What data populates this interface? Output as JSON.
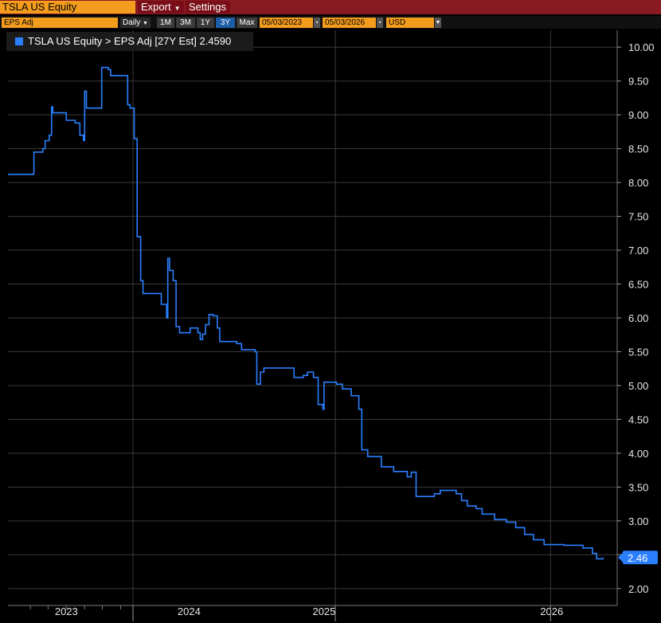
{
  "header": {
    "ticker": "TSLA US Equity",
    "export_label": "Export",
    "settings_label": "Settings"
  },
  "toolbar": {
    "field": "EPS Adj",
    "periodicity": "Daily",
    "ranges": [
      "1M",
      "3M",
      "1Y",
      "3Y",
      "Max"
    ],
    "active_range": "3Y",
    "start_date": "05/03/2023",
    "end_date": "05/03/2026",
    "currency": "USD"
  },
  "legend": {
    "text": "TSLA US Equity > EPS Adj [27Y Est]  2.4590",
    "color": "#2a7fff"
  },
  "colors": {
    "line": "#2a7fff",
    "grid": "#3a3a3a",
    "last_label_bg": "#2a7fff"
  },
  "chart_data": {
    "type": "line",
    "title": "",
    "series": [
      {
        "name": "TSLA US Equity > EPS Adj [27Y Est]",
        "last_value": 2.459,
        "last_label": "2.46",
        "points": [
          [
            "2023-05-03",
            8.12
          ],
          [
            "2023-06-15",
            8.13
          ],
          [
            "2023-06-16",
            8.45
          ],
          [
            "2023-07-01",
            8.5
          ],
          [
            "2023-07-05",
            8.62
          ],
          [
            "2023-07-12",
            8.7
          ],
          [
            "2023-07-16",
            9.12
          ],
          [
            "2023-07-18",
            9.03
          ],
          [
            "2023-08-10",
            8.92
          ],
          [
            "2023-08-25",
            8.88
          ],
          [
            "2023-09-02",
            8.7
          ],
          [
            "2023-09-08",
            8.62
          ],
          [
            "2023-09-10",
            9.35
          ],
          [
            "2023-09-13",
            9.1
          ],
          [
            "2023-10-08",
            9.1
          ],
          [
            "2023-10-09",
            9.7
          ],
          [
            "2023-10-20",
            9.67
          ],
          [
            "2023-10-24",
            9.58
          ],
          [
            "2023-11-20",
            9.58
          ],
          [
            "2023-11-22",
            9.15
          ],
          [
            "2023-11-26",
            9.1
          ],
          [
            "2023-12-03",
            8.65
          ],
          [
            "2023-12-08",
            7.2
          ],
          [
            "2023-12-14",
            6.55
          ],
          [
            "2023-12-18",
            6.36
          ],
          [
            "2024-01-10",
            6.36
          ],
          [
            "2024-01-18",
            6.2
          ],
          [
            "2024-01-23",
            6.2
          ],
          [
            "2024-01-27",
            6.0
          ],
          [
            "2024-01-29",
            6.88
          ],
          [
            "2024-02-01",
            6.7
          ],
          [
            "2024-02-07",
            6.55
          ],
          [
            "2024-02-12",
            5.87
          ],
          [
            "2024-02-18",
            5.78
          ],
          [
            "2024-03-04",
            5.78
          ],
          [
            "2024-03-07",
            5.85
          ],
          [
            "2024-03-20",
            5.78
          ],
          [
            "2024-03-24",
            5.68
          ],
          [
            "2024-03-28",
            5.76
          ],
          [
            "2024-04-02",
            5.9
          ],
          [
            "2024-04-08",
            6.05
          ],
          [
            "2024-04-15",
            6.03
          ],
          [
            "2024-04-22",
            5.85
          ],
          [
            "2024-04-26",
            5.65
          ],
          [
            "2024-05-25",
            5.62
          ],
          [
            "2024-06-02",
            5.53
          ],
          [
            "2024-06-25",
            5.5
          ],
          [
            "2024-06-28",
            5.02
          ],
          [
            "2024-07-04",
            5.2
          ],
          [
            "2024-07-10",
            5.26
          ],
          [
            "2024-08-25",
            5.26
          ],
          [
            "2024-08-30",
            5.12
          ],
          [
            "2024-09-15",
            5.15
          ],
          [
            "2024-09-22",
            5.2
          ],
          [
            "2024-10-02",
            5.12
          ],
          [
            "2024-10-10",
            4.72
          ],
          [
            "2024-10-18",
            4.65
          ],
          [
            "2024-10-20",
            5.05
          ],
          [
            "2024-11-10",
            5.02
          ],
          [
            "2024-11-20",
            4.95
          ],
          [
            "2024-12-05",
            4.85
          ],
          [
            "2024-12-18",
            4.65
          ],
          [
            "2024-12-23",
            4.05
          ],
          [
            "2025-01-02",
            3.95
          ],
          [
            "2025-01-25",
            3.8
          ],
          [
            "2025-02-15",
            3.73
          ],
          [
            "2025-03-10",
            3.65
          ],
          [
            "2025-03-17",
            3.72
          ],
          [
            "2025-03-25",
            3.36
          ],
          [
            "2025-04-05",
            3.36
          ],
          [
            "2025-04-25",
            3.4
          ],
          [
            "2025-05-05",
            3.45
          ],
          [
            "2025-06-01",
            3.4
          ],
          [
            "2025-06-10",
            3.3
          ],
          [
            "2025-06-20",
            3.22
          ],
          [
            "2025-07-05",
            3.18
          ],
          [
            "2025-07-15",
            3.1
          ],
          [
            "2025-08-05",
            3.02
          ],
          [
            "2025-08-25",
            2.98
          ],
          [
            "2025-09-10",
            2.9
          ],
          [
            "2025-09-25",
            2.8
          ],
          [
            "2025-10-10",
            2.72
          ],
          [
            "2025-10-28",
            2.65
          ],
          [
            "2025-12-01",
            2.64
          ],
          [
            "2026-01-02",
            2.6
          ],
          [
            "2026-01-18",
            2.52
          ],
          [
            "2026-01-25",
            2.44
          ],
          [
            "2026-02-05",
            2.46
          ]
        ]
      }
    ],
    "xlabel": "",
    "ylabel": "",
    "ylim": [
      1.75,
      10.25
    ],
    "y_ticks": [
      "2.00",
      "2.50",
      "3.00",
      "3.50",
      "4.00",
      "4.50",
      "5.00",
      "5.50",
      "6.00",
      "6.50",
      "7.00",
      "7.50",
      "8.00",
      "8.50",
      "9.00",
      "9.50",
      "10.00"
    ],
    "x_ticks": [
      "2023",
      "2024",
      "2025",
      "2026"
    ],
    "x_range": [
      "2023-05-03",
      "2026-03-01"
    ],
    "x_tick_dates": [
      "2023-08-10",
      "2024-03-05",
      "2024-10-20",
      "2025-11-10"
    ],
    "x_gridline_dates": [
      "2023-12-01",
      "2024-11-08",
      "2025-11-08",
      "2026-03-01"
    ],
    "grid": true,
    "legend_position": "top-left",
    "axis_side": "right"
  }
}
